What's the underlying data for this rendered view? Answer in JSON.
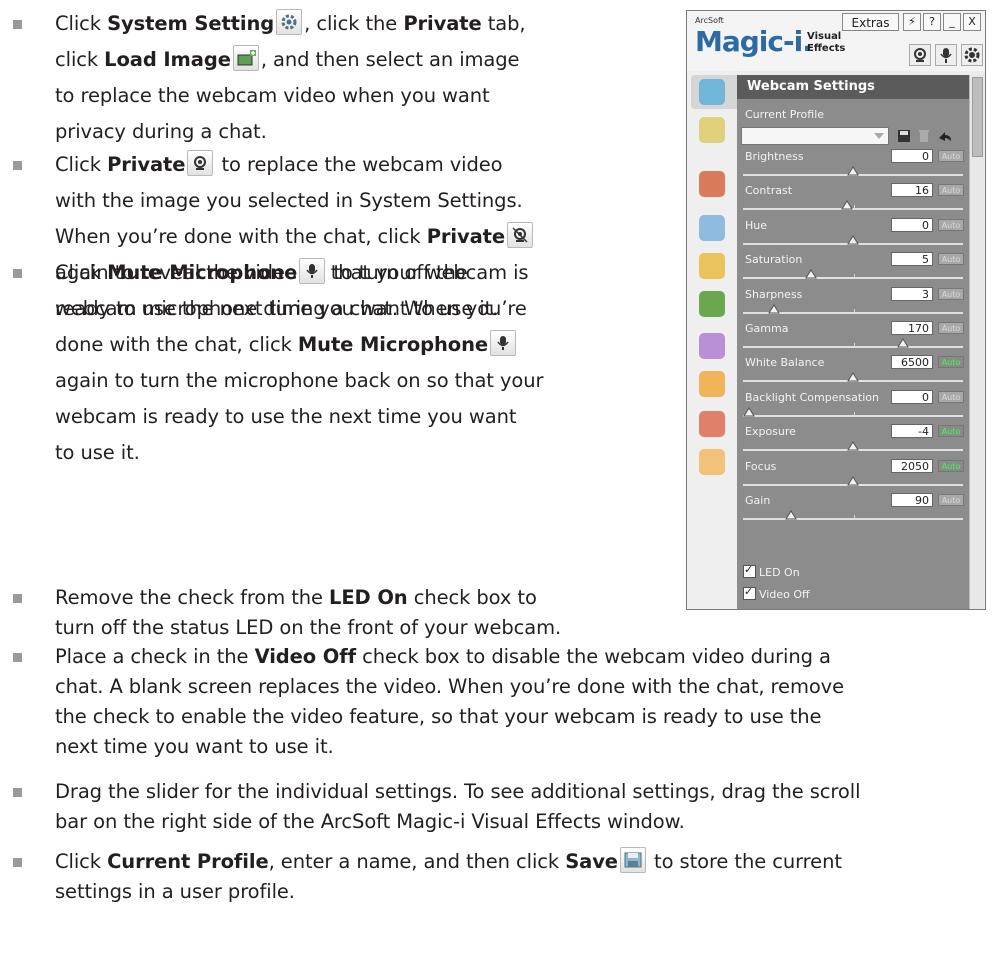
{
  "bullets": [
    {
      "lines": [
        [
          {
            "t": "Click "
          },
          {
            "t": "System Setting",
            "b": true
          },
          {
            "icon": "gear-icon"
          },
          {
            "t": ", click the "
          },
          {
            "t": "Private",
            "b": true
          },
          {
            "t": " tab,"
          }
        ],
        [
          {
            "t": "click "
          },
          {
            "t": "Load Image",
            "b": true
          },
          {
            "icon": "load-image-icon"
          },
          {
            "t": ", and then select an image"
          }
        ],
        [
          {
            "t": "to replace the webcam video when you want"
          }
        ],
        [
          {
            "t": "privacy during a chat."
          }
        ]
      ]
    },
    {
      "lines": [
        [
          {
            "t": "Click "
          },
          {
            "t": "Private",
            "b": true
          },
          {
            "icon": "private-icon"
          },
          {
            "t": " to replace the webcam video"
          }
        ],
        [
          {
            "t": "with the image you selected in System Settings."
          }
        ],
        [
          {
            "t": "When you’re done with the chat, click "
          },
          {
            "t": "Private",
            "b": true
          },
          {
            "icon": "private-off-icon"
          }
        ],
        [
          {
            "t": "again to reveal the video so that your webcam is"
          }
        ],
        [
          {
            "t": "ready to use the next time you want to use it."
          }
        ]
      ]
    },
    {
      "lines": [
        [
          {
            "t": "Click "
          },
          {
            "t": "Mute Microphone",
            "b": true
          },
          {
            "icon": "microphone-icon"
          },
          {
            "t": " to turn off the"
          }
        ],
        [
          {
            "t": "webcam microphone during a chat. When you’re"
          }
        ],
        [
          {
            "t": "done with the chat, click "
          },
          {
            "t": "Mute Microphone",
            "b": true
          },
          {
            "icon": "microphone-icon"
          }
        ],
        [
          {
            "t": "again to turn the microphone back on so that your"
          }
        ],
        [
          {
            "t": "webcam is ready to use the next time you want"
          }
        ],
        [
          {
            "t": "to use it."
          }
        ]
      ]
    },
    {
      "lines": [
        [
          {
            "t": "Remove the check from the "
          },
          {
            "t": "LED On",
            "b": true
          },
          {
            "t": " check box to"
          }
        ],
        [
          {
            "t": "turn off the status LED on the front of your webcam."
          }
        ]
      ]
    },
    {
      "lines": [
        [
          {
            "t": "Place a check in the "
          },
          {
            "t": "Video Off",
            "b": true
          },
          {
            "t": " check box to disable the webcam video during a"
          }
        ],
        [
          {
            "t": "chat. A blank screen replaces the video. When you’re done with the chat, remove"
          }
        ],
        [
          {
            "t": "the check to enable the video feature, so that your webcam is ready to use the"
          }
        ],
        [
          {
            "t": "next time you want to use it."
          }
        ]
      ]
    },
    {
      "lines": [
        [
          {
            "t": "Drag the slider for the individual settings. To see additional settings, drag the scroll"
          }
        ],
        [
          {
            "t": "bar on the right side of the ArcSoft Magic-i Visual Effects window."
          }
        ]
      ]
    },
    {
      "lines": [
        [
          {
            "t": "Click "
          },
          {
            "t": "Current Profile",
            "b": true
          },
          {
            "t": ", enter a name, and then click "
          },
          {
            "t": "Save",
            "b": true
          },
          {
            "icon": "save-icon"
          },
          {
            "t": " to store the current"
          }
        ],
        [
          {
            "t": "settings in a user profile."
          }
        ]
      ]
    }
  ],
  "window": {
    "brand_small": "ArcSoft",
    "brand_main": "Magic-i.",
    "brand_visual": "Visual",
    "brand_effects": "Effects",
    "extras_label": "Extras",
    "tbtn_labels": [
      "⚡",
      "?",
      "_",
      "X"
    ],
    "panel_title": "Webcam Settings",
    "current_profile_label": "Current Profile",
    "settings": [
      {
        "name": "Brightness",
        "value": "0",
        "auto": false,
        "level": 0.5
      },
      {
        "name": "Contrast",
        "value": "16",
        "auto": false,
        "level": 0.47
      },
      {
        "name": "Hue",
        "value": "0",
        "auto": false,
        "level": 0.5
      },
      {
        "name": "Saturation",
        "value": "5",
        "auto": false,
        "level": 0.3
      },
      {
        "name": "Sharpness",
        "value": "3",
        "auto": false,
        "level": 0.12
      },
      {
        "name": "Gamma",
        "value": "170",
        "auto": false,
        "level": 0.74
      },
      {
        "name": "White Balance",
        "value": "6500",
        "auto": true,
        "level": 0.5
      },
      {
        "name": "Backlight Compensation",
        "value": "0",
        "auto": false,
        "level": 0.0
      },
      {
        "name": "Exposure",
        "value": "-4",
        "auto": true,
        "level": 0.5
      },
      {
        "name": "Focus",
        "value": "2050",
        "auto": true,
        "level": 0.5
      },
      {
        "name": "Gain",
        "value": "90",
        "auto": false,
        "level": 0.2
      }
    ],
    "auto_label": "Auto",
    "led_on_label": "LED On",
    "video_off_label": "Video Off"
  }
}
